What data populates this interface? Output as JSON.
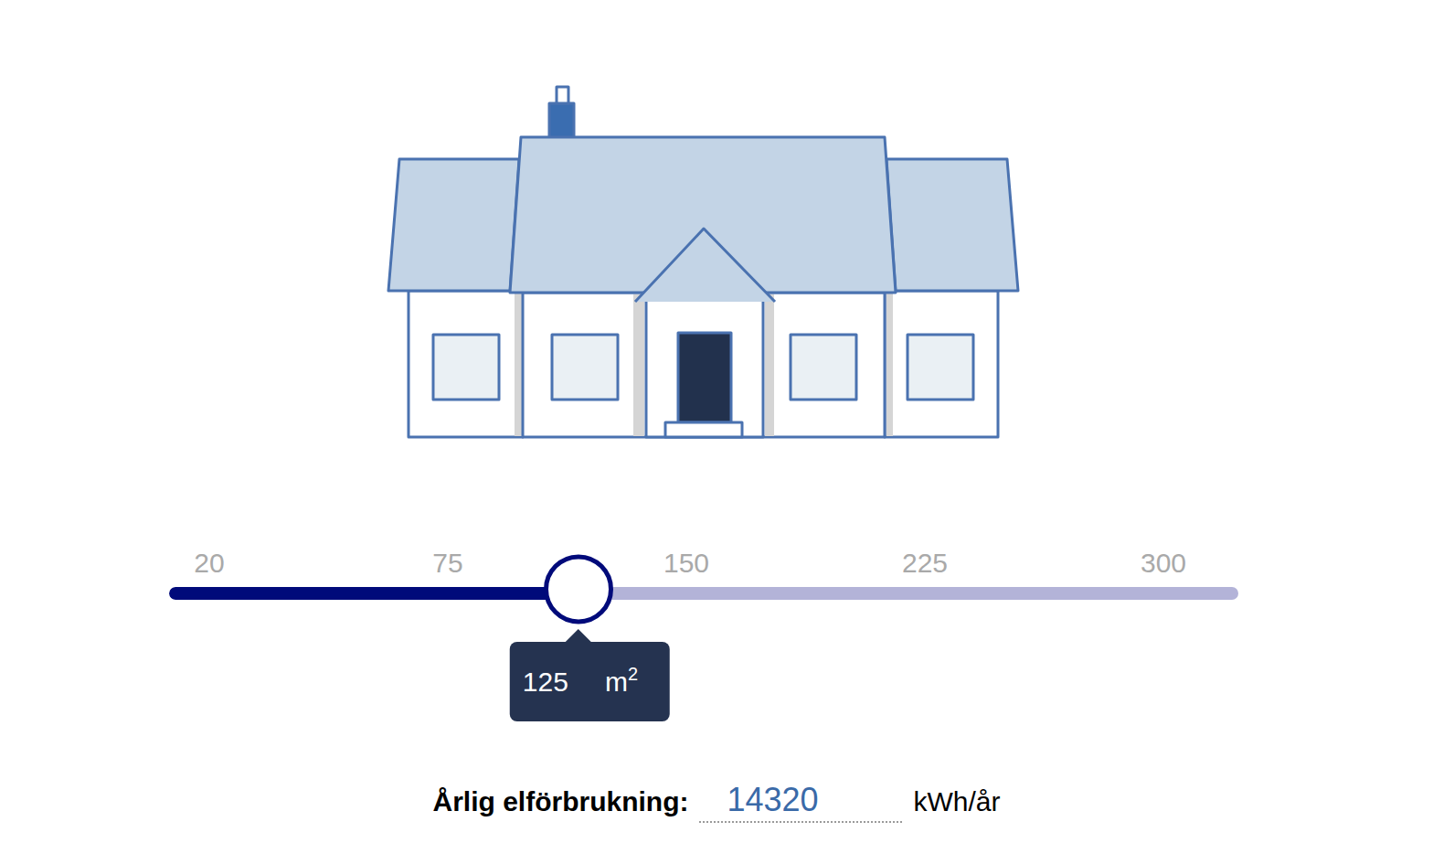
{
  "slider": {
    "ticks": [
      "20",
      "75",
      "150",
      "225",
      "300"
    ],
    "level": 0.383,
    "value": "125",
    "unit": "m",
    "unit_exponent": "2"
  },
  "consumption": {
    "label": "Årlig elförbrukning:",
    "value": "14320",
    "unit": "kWh/år"
  }
}
